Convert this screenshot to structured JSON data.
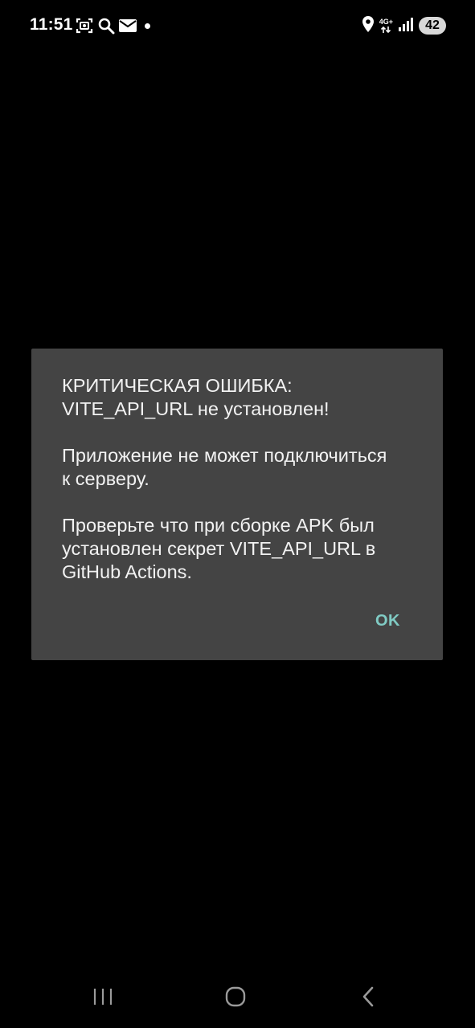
{
  "status_bar": {
    "time": "11:51",
    "left_icons": [
      "screenshot-icon",
      "search-icon",
      "mail-icon",
      "notification-dot-icon"
    ],
    "right_icons": [
      "location-icon",
      "network-4g-icon",
      "signal-icon",
      "battery-icon"
    ],
    "network_type": "4G+",
    "battery_level": "42"
  },
  "dialog": {
    "message_paragraphs": [
      {
        "line1": "КРИТИЧЕСКАЯ ОШИБКА:",
        "line2": "VITE_API_URL не установлен!"
      },
      {
        "line1": "Приложение не может подключиться",
        "line2": "к серверу."
      },
      {
        "line1": "Проверьте что при сборке APK был",
        "line2": "установлен секрет VITE_API_URL в",
        "line3": "GitHub Actions."
      }
    ],
    "ok_label": "OK",
    "background_color": "#444444",
    "accent_color": "#80cbc4"
  },
  "nav_bar": {
    "buttons": [
      "recents-icon",
      "home-icon",
      "back-icon"
    ]
  }
}
